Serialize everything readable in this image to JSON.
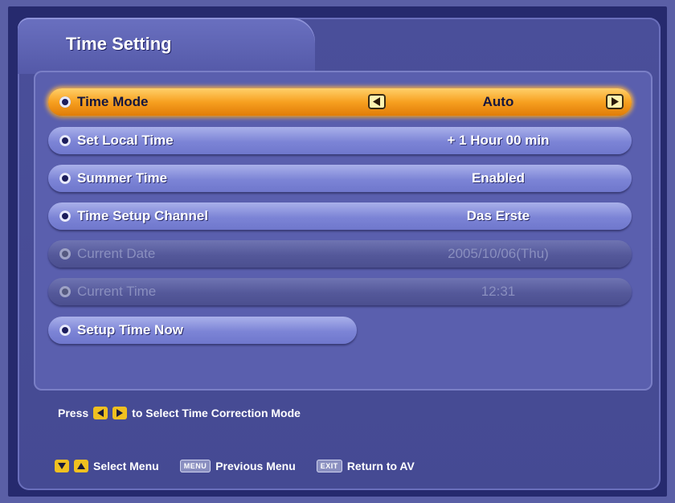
{
  "title": "Time Setting",
  "menu": [
    {
      "label": "Time Mode",
      "value": "Auto",
      "state": "selected"
    },
    {
      "label": "Set Local Time",
      "value": "+ 1 Hour 00 min",
      "state": "normal"
    },
    {
      "label": "Summer Time",
      "value": "Enabled",
      "state": "normal"
    },
    {
      "label": "Time Setup Channel",
      "value": "Das Erste",
      "state": "normal"
    },
    {
      "label": "Current Date",
      "value": "2005/10/06(Thu)",
      "state": "disabled"
    },
    {
      "label": "Current Time",
      "value": "12:31",
      "state": "disabled"
    },
    {
      "label": "Setup Time Now",
      "value": "",
      "state": "normal"
    }
  ],
  "hint": {
    "press": "Press",
    "text": "to Select Time Correction Mode"
  },
  "footer": {
    "select_menu": "Select Menu",
    "menu_key": "MENU",
    "previous_menu": "Previous Menu",
    "exit_key": "EXIT",
    "return_av": "Return to AV"
  },
  "colors": {
    "background": "#5a5fa6",
    "selected_row": "#f7a020",
    "row": "#7c84d6",
    "disabled_row": "#54589a"
  }
}
